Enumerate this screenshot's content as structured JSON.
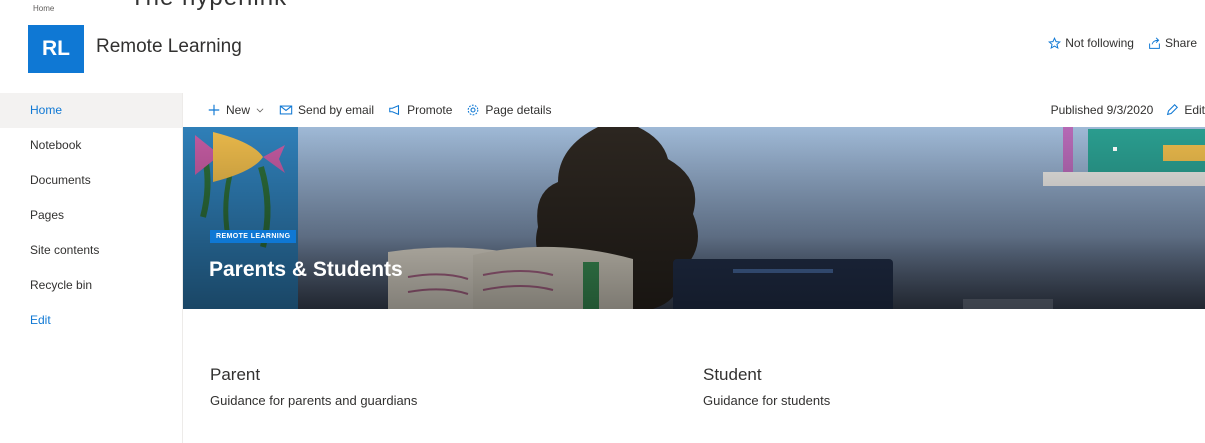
{
  "overlay_text": "The hyperlink",
  "breadcrumb": "Home",
  "logo_initials": "RL",
  "site_title": "Remote Learning",
  "header_actions": {
    "follow_label": "Not following",
    "share_label": "Share"
  },
  "nav": {
    "items": [
      {
        "label": "Home",
        "active": true
      },
      {
        "label": "Notebook"
      },
      {
        "label": "Documents"
      },
      {
        "label": "Pages"
      },
      {
        "label": "Site contents"
      },
      {
        "label": "Recycle bin"
      }
    ],
    "edit_label": "Edit"
  },
  "commandbar": {
    "new_label": "New",
    "send_label": "Send by email",
    "promote_label": "Promote",
    "details_label": "Page details",
    "published": "Published 9/3/2020",
    "edit_label": "Edit"
  },
  "hero": {
    "tag": "REMOTE LEARNING",
    "title": "Parents & Students"
  },
  "sections": [
    {
      "title": "Parent",
      "desc": "Guidance for parents and guardians"
    },
    {
      "title": "Student",
      "desc": "Guidance for students"
    }
  ],
  "colors": {
    "accent": "#0f78d4",
    "nav_active_bg": "#f3f2f1",
    "text": "#323130"
  },
  "icons": [
    "star-icon",
    "share-icon",
    "plus-icon",
    "chevron-down-icon",
    "mail-icon",
    "megaphone-icon",
    "gear-icon",
    "pencil-icon"
  ]
}
